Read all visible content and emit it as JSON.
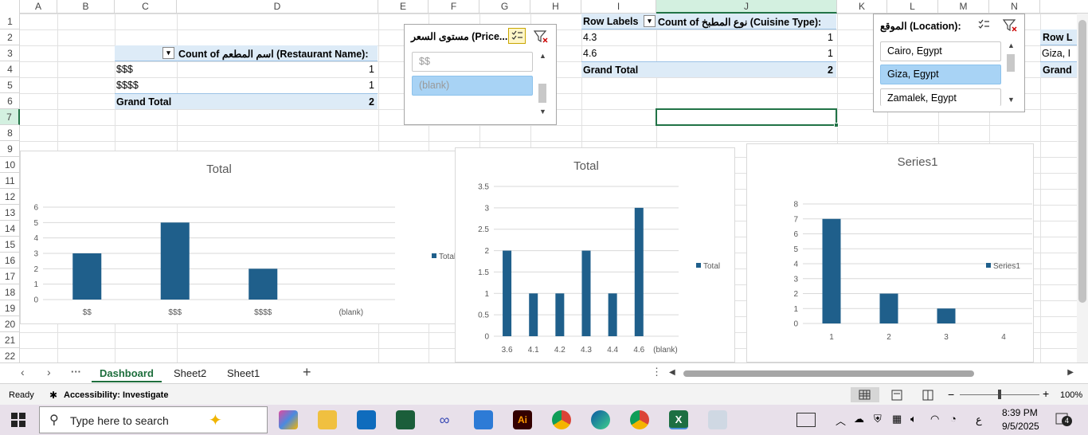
{
  "columns": [
    "A",
    "B",
    "C",
    "D",
    "E",
    "F",
    "G",
    "H",
    "I",
    "J",
    "K",
    "L",
    "M",
    "N"
  ],
  "rows": [
    "1",
    "2",
    "3",
    "4",
    "5",
    "6",
    "7",
    "8",
    "9",
    "10",
    "11",
    "12",
    "13",
    "14",
    "15",
    "16",
    "17",
    "18",
    "19",
    "20",
    "21",
    "22"
  ],
  "pivot1": {
    "header": "Count of اسم المطعم (Restaurant Name):",
    "rows": [
      {
        "label": "$$$",
        "value": "1"
      },
      {
        "label": "$$$$",
        "value": "1"
      }
    ],
    "total_label": "Grand Total",
    "total_value": "2"
  },
  "pivot2": {
    "row_labels": "Row Labels",
    "header": "Count of نوع المطبخ (Cuisine Type):",
    "rows": [
      {
        "label": "4.3",
        "value": "1"
      },
      {
        "label": "4.6",
        "value": "1"
      }
    ],
    "total_label": "Grand Total",
    "total_value": "2"
  },
  "pivot3": {
    "row_labels": "Row L",
    "row1": "Giza, I",
    "total": "Grand"
  },
  "slicer_price": {
    "title": "مستوى السعر (Price...",
    "items": [
      "$$",
      "(blank)"
    ]
  },
  "slicer_location": {
    "title": "الموقع (Location):",
    "items": [
      "Cairo, Egypt",
      "Giza, Egypt",
      "Zamalek, Egypt"
    ]
  },
  "chart_data": [
    {
      "type": "bar",
      "title": "Total",
      "categories": [
        "$$",
        "$$$",
        "$$$$",
        "(blank)"
      ],
      "series": [
        {
          "name": "Total",
          "values": [
            3,
            5,
            2,
            0
          ]
        }
      ],
      "ylim": [
        0,
        6
      ],
      "yticks": [
        "0",
        "1",
        "2",
        "3",
        "4",
        "5",
        "6"
      ],
      "color": "#1f5f8b",
      "legend": "right"
    },
    {
      "type": "bar",
      "title": "Total",
      "categories": [
        "3.6",
        "4.1",
        "4.2",
        "4.3",
        "4.4",
        "4.6",
        "(blank)"
      ],
      "series": [
        {
          "name": "Total",
          "values": [
            2,
            1,
            1,
            2,
            1,
            3,
            0
          ]
        }
      ],
      "ylim": [
        0,
        3.5
      ],
      "yticks": [
        "0",
        "0.5",
        "1",
        "1.5",
        "2",
        "2.5",
        "3",
        "3.5"
      ],
      "color": "#1f5f8b",
      "legend": "right"
    },
    {
      "type": "bar",
      "title": "Series1",
      "categories": [
        "1",
        "2",
        "3",
        "4"
      ],
      "series": [
        {
          "name": "Series1",
          "values": [
            7,
            2,
            1,
            0
          ]
        }
      ],
      "ylim": [
        0,
        8
      ],
      "yticks": [
        "0",
        "1",
        "2",
        "3",
        "4",
        "5",
        "6",
        "7",
        "8"
      ],
      "color": "#1f5f8b",
      "legend": "right"
    }
  ],
  "sheet_tabs": [
    "Dashboard",
    "Sheet2",
    "Sheet1"
  ],
  "status": {
    "ready": "Ready",
    "accessibility": "Accessibility: Investigate",
    "zoom": "100%"
  },
  "taskbar": {
    "search_placeholder": "Type here to search",
    "time": "8:39 PM",
    "date": "9/5/2025",
    "lang": "ع",
    "notifications": "4"
  }
}
